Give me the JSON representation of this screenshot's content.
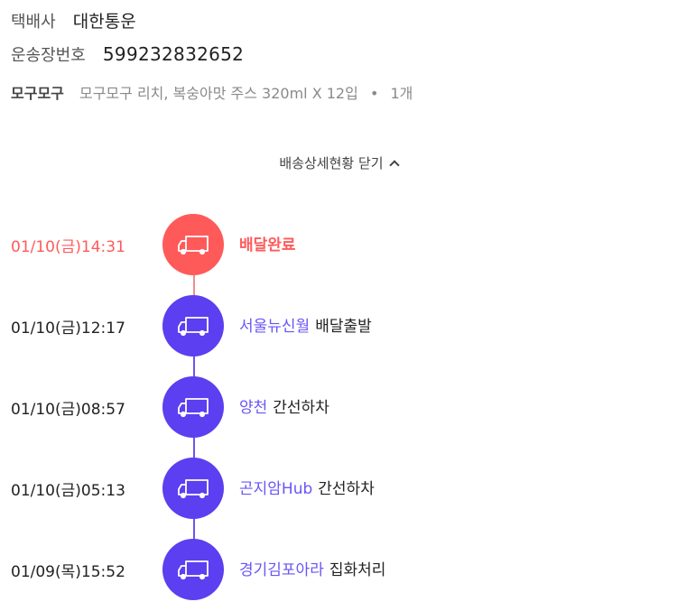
{
  "carrier": {
    "label": "택배사",
    "value": "대한통운"
  },
  "tracking": {
    "label": "운송장번호",
    "value": "599232832652"
  },
  "product": {
    "brand": "모구모구",
    "name": "모구모구 리치, 복숭아맛 주스 320ml X 12입",
    "separator": "•",
    "quantity": "1개"
  },
  "toggle_label": "배송상세현황 닫기",
  "colors": {
    "active": "#ff5a5a",
    "purple": "#5b3ff0",
    "location": "#6a55f6"
  },
  "events": [
    {
      "time": "01/10(금)14:31",
      "location": "",
      "status": "배달완료",
      "icon": "truck-icon",
      "active": true
    },
    {
      "time": "01/10(금)12:17",
      "location": "서울뉴신월",
      "status": "배달출발",
      "icon": "truck-icon",
      "active": false
    },
    {
      "time": "01/10(금)08:57",
      "location": "양천",
      "status": "간선하차",
      "icon": "truck-icon",
      "active": false
    },
    {
      "time": "01/10(금)05:13",
      "location": "곤지암Hub",
      "status": "간선하차",
      "icon": "truck-icon",
      "active": false
    },
    {
      "time": "01/09(목)15:52",
      "location": "경기김포아라",
      "status": "집화처리",
      "icon": "truck-icon",
      "active": false
    }
  ]
}
